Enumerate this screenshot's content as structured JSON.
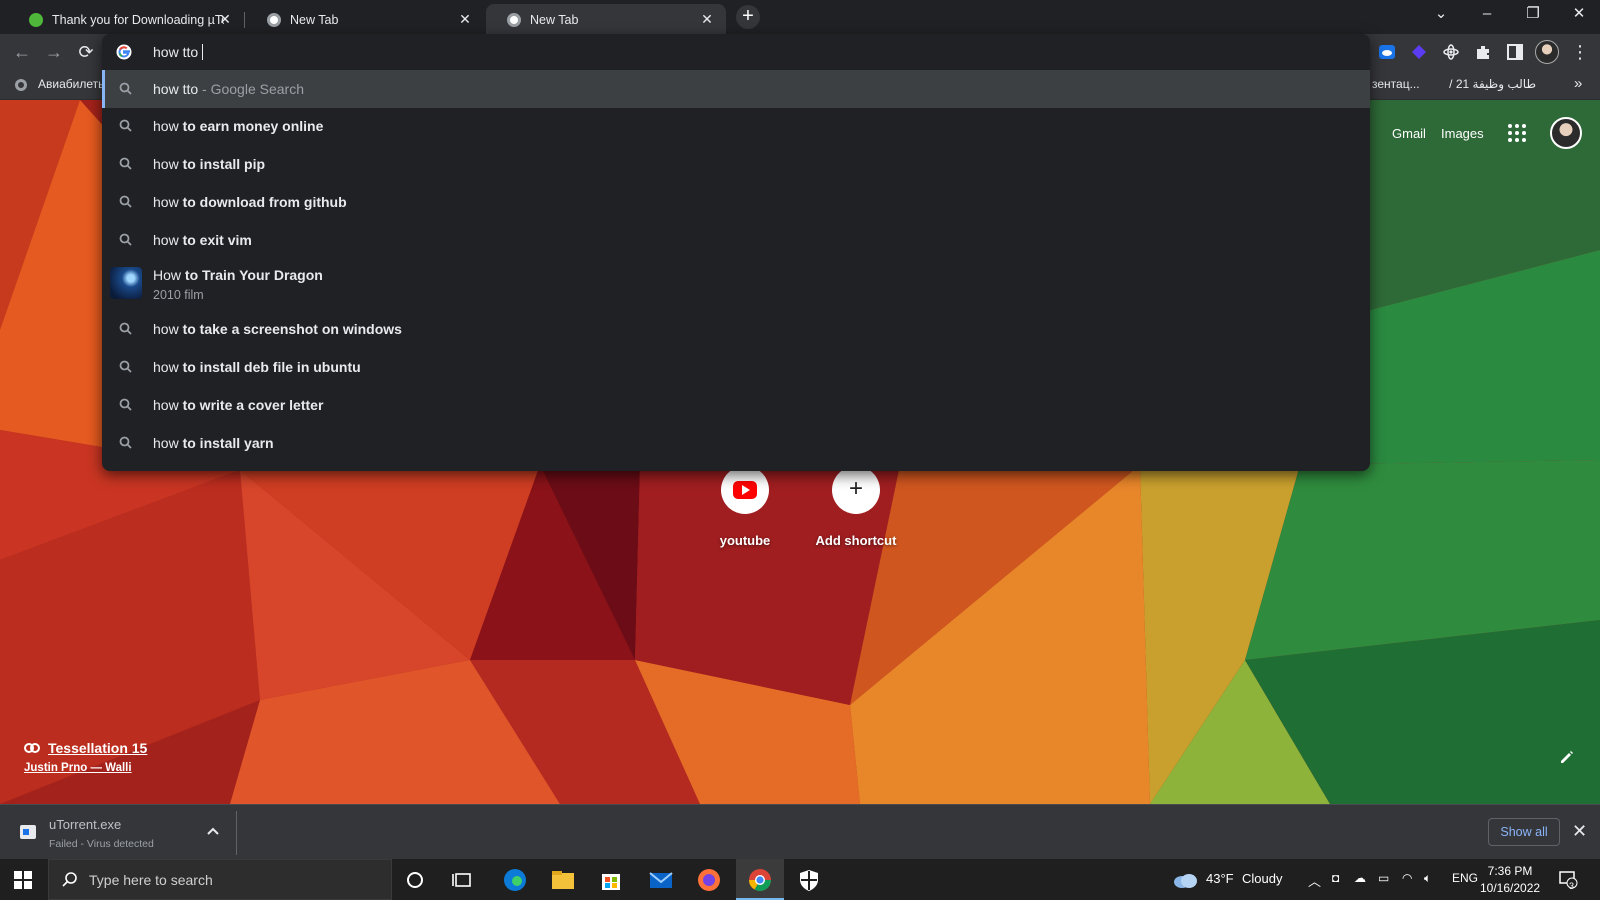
{
  "tabs": [
    {
      "title": "Thank you for Downloading µTorrent",
      "active": false
    },
    {
      "title": "New Tab",
      "active": false
    },
    {
      "title": "New Tab",
      "active": true
    }
  ],
  "omnibox": {
    "query": "how tto",
    "first": {
      "query": "how tto",
      "suffix": " - Google Search"
    },
    "suggestions": [
      {
        "prefix": "how ",
        "bold": "to earn money online"
      },
      {
        "prefix": "how ",
        "bold": "to install pip"
      },
      {
        "prefix": "how ",
        "bold": "to download from github"
      },
      {
        "prefix": "how ",
        "bold": "to exit vim"
      }
    ],
    "entity": {
      "prefix": "How ",
      "bold": "to Train Your Dragon",
      "subtitle": "2010 film"
    },
    "suggestions2": [
      {
        "prefix": "how ",
        "bold": "to take a screenshot on windows"
      },
      {
        "prefix": "how ",
        "bold": "to install deb file in ubuntu"
      },
      {
        "prefix": "how ",
        "bold": "to write a cover letter"
      },
      {
        "prefix": "how ",
        "bold": "to install yarn"
      }
    ]
  },
  "bookmarks": {
    "left": "Авиабилеты",
    "right_partial": "зентац...",
    "arabic": "طالب وظيفة 21 /"
  },
  "ntp": {
    "gmail": "Gmail",
    "images": "Images",
    "shortcuts": [
      {
        "label": "youtube"
      },
      {
        "label": "Add shortcut"
      }
    ],
    "attribution": {
      "title": "Tessellation 15",
      "author": "Justin Prno — Walli"
    }
  },
  "download": {
    "filename": "uTorrent.exe",
    "status": "Failed - Virus detected",
    "show_all": "Show all"
  },
  "taskbar": {
    "search_placeholder": "Type here to search",
    "weather_temp": "43°F",
    "weather_desc": "Cloudy",
    "lang": "ENG",
    "time": "7:36 PM",
    "date": "10/16/2022",
    "notif_count": "3"
  },
  "colors": {
    "selection_accent": "#8ab4f8",
    "chrome_dark": "#202124",
    "toolbar": "#35363a",
    "youtube_red": "#ff0000"
  }
}
